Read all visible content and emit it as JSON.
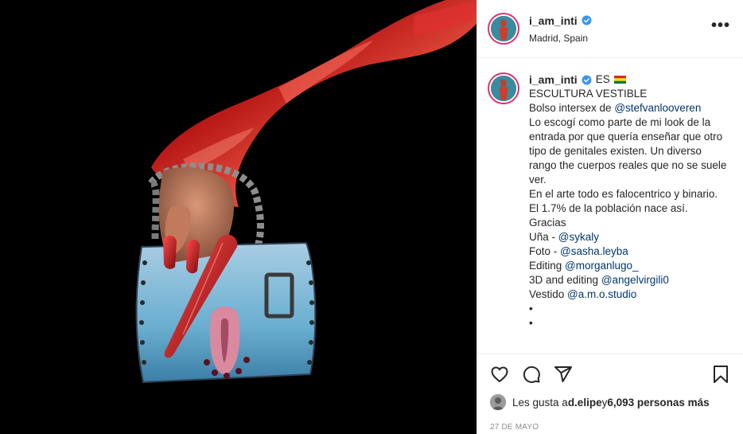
{
  "post": {
    "username": "i_am_inti",
    "location": "Madrid, Spain",
    "more_icon": "more-horizontal-icon"
  },
  "caption": {
    "username": "i_am_inti",
    "lang": "ES",
    "lines": [
      {
        "text": "ESCULTURA VESTIBLE"
      },
      {
        "text": "Bolso intersex de ",
        "mention": "@stefvanlooveren"
      },
      {
        "text": "Lo escogí como parte de mi look de la entrada por que quería enseñar que otro tipo de genitales existen. Un diverso rango the cuerpos reales que no se suele ver."
      },
      {
        "text": "En el arte todo es falocentrico y binario."
      },
      {
        "text": "El 1.7% de la población nace así."
      },
      {
        "text": "Gracias"
      },
      {
        "text": "Uña - ",
        "mention": "@sykaly"
      },
      {
        "text": "Foto - ",
        "mention": "@sasha.leyba"
      },
      {
        "text": "Editing ",
        "mention": "@morganlugo_"
      },
      {
        "text": "3D and editing ",
        "mention": "@angelvirgili0"
      },
      {
        "text": "Vestido ",
        "mention": "@a.m.o.studio"
      },
      {
        "text": "•"
      },
      {
        "text": "•"
      }
    ]
  },
  "actions": {
    "like_icon": "heart-icon",
    "comment_icon": "comment-icon",
    "share_icon": "share-icon",
    "save_icon": "bookmark-icon"
  },
  "likes": {
    "prefix": "Les gusta a ",
    "user": "d.elipe",
    "middle": " y ",
    "count": "6,093 personas más"
  },
  "date": "27 DE MAYO",
  "colors": {
    "mention": "#00376b",
    "verified": "#3897f0",
    "secondary": "#8e8e8e"
  }
}
